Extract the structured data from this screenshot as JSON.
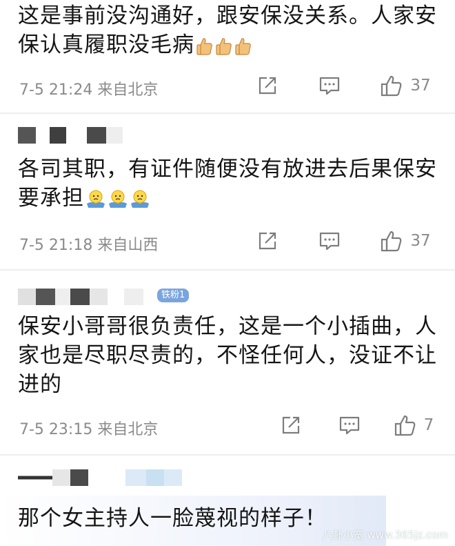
{
  "comments": [
    {
      "text": "这是事前没沟通好，跟安保没关系。人家安保认真履职没毛病",
      "emoji_name": "thumbs-up-icon",
      "emoji_count": 3,
      "meta": "7-5 21:24 来自北京",
      "like_count": "37"
    },
    {
      "text": "各司其职，有证件随便没有放进去后果保安要承担",
      "emoji_name": "shrug-face-icon",
      "emoji_count": 3,
      "meta": "7-5 21:18 来自山西",
      "like_count": "37"
    },
    {
      "badge": "铁粉1",
      "text": "保安小哥哥很负责任，这是一个小插曲，人家也是尽职尽责的，不怪任何人，没证不让进的",
      "meta": "7-5 23:15 来自北京",
      "like_count": "7"
    },
    {
      "text": "那个女主持人一脸蔑视的样子！"
    }
  ],
  "watermark": "八卦小宽 www.365jz.com",
  "colors": {
    "text": "#151515",
    "meta": "#8a8a8a",
    "icon": "#7c7c7c",
    "badge": "#7aa4de"
  },
  "icons": [
    "share-icon",
    "comment-icon",
    "like-icon"
  ]
}
